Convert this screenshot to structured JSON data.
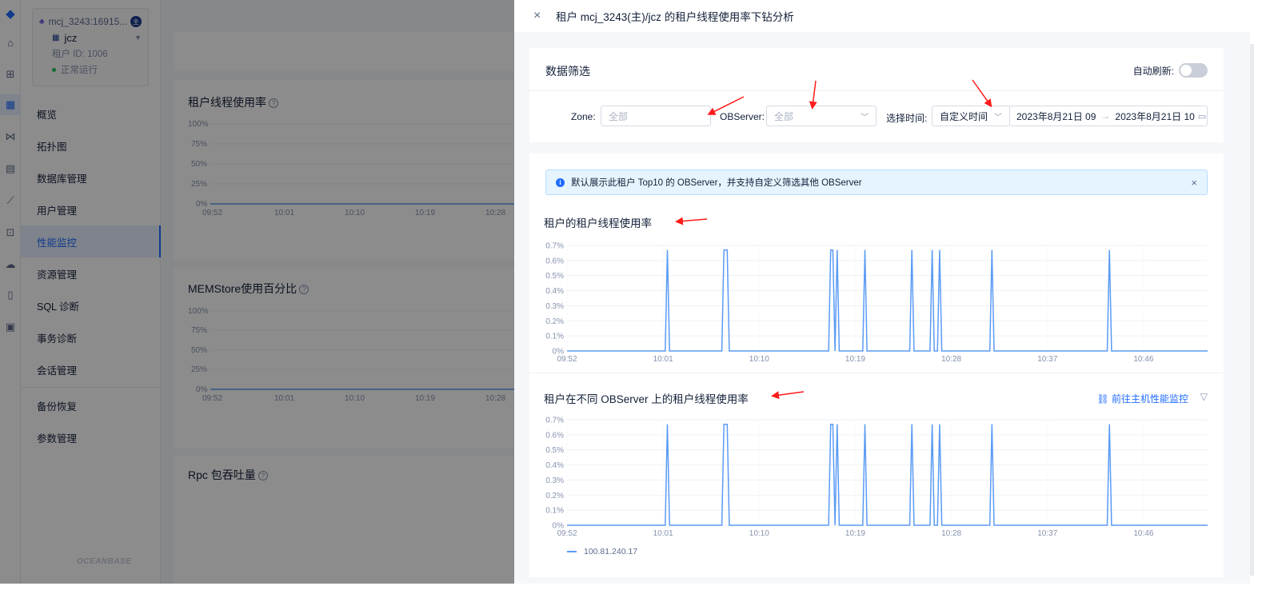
{
  "sidebar": {
    "cluster_name": "mcj_3243:16915...",
    "tenant_name": "jcz",
    "tenant_id": "租户 ID: 1006",
    "status": "正常运行",
    "nav": [
      "概览",
      "拓扑图",
      "数据库管理",
      "用户管理",
      "性能监控",
      "资源管理",
      "SQL 诊断",
      "事务诊断",
      "会话管理",
      "备份恢复",
      "参数管理"
    ],
    "active_item": "性能监控",
    "brand": "OCEANBASE"
  },
  "background_panels": {
    "panel1_title": "租户线程使用率",
    "panel2_title": "MEMStore使用百分比",
    "panel3_title": "Rpc 包吞吐量",
    "y_ticks": [
      "100%",
      "75%",
      "50%",
      "25%",
      "0%"
    ],
    "x_ticks": [
      "09:52",
      "10:01",
      "10:10",
      "10:19",
      "10:28"
    ]
  },
  "drawer": {
    "close_label": "×",
    "title": "租户 mcj_3243(主)/jcz 的租户线程使用率下钻分析",
    "filter_title": "数据筛选",
    "auto_refresh_label": "自动刷新:",
    "zone_label": "Zone:",
    "zone_value": "全部",
    "observer_label": "OBServer:",
    "observer_value": "全部",
    "time_label": "选择时间:",
    "time_mode": "自定义时间",
    "time_start": "2023年8月21日 09",
    "time_arrow": "→",
    "time_end": "2023年8月21日 10",
    "alert_text": "默认展示此租户 Top10 的 OBServer，并支持自定义筛选其他 OBServer",
    "section1_title": "租户的租户线程使用率",
    "section2_title": "租户在不同 OBServer 上的租户线程使用率",
    "link_text": "前往主机性能监控",
    "legend_label": "100.81.240.17"
  },
  "colors": {
    "accent": "#1f6bff",
    "series": "#5b9bf5",
    "arrow": "#ff1a1a"
  },
  "chart_data": [
    {
      "type": "line",
      "title": "租户的租户线程使用率",
      "y_ticks": [
        "0.7%",
        "0.6%",
        "0.5%",
        "0.4%",
        "0.3%",
        "0.2%",
        "0.1%",
        "0%"
      ],
      "x_ticks": [
        "09:52",
        "10:01",
        "10:10",
        "10:19",
        "10:28",
        "10:37",
        "10:46"
      ],
      "ylim": [
        0,
        0.7
      ],
      "x_range": [
        0,
        60
      ],
      "series": [
        {
          "values": [
            [
              0,
              0
            ],
            [
              9.2,
              0
            ],
            [
              9.4,
              0.67
            ],
            [
              9.6,
              0
            ],
            [
              14.5,
              0
            ],
            [
              14.7,
              0.67
            ],
            [
              15.0,
              0.67
            ],
            [
              15.2,
              0
            ],
            [
              24.5,
              0
            ],
            [
              24.7,
              0.67
            ],
            [
              24.9,
              0.67
            ],
            [
              25.1,
              0
            ],
            [
              25.3,
              0.67
            ],
            [
              25.5,
              0
            ],
            [
              27.7,
              0
            ],
            [
              27.9,
              0.67
            ],
            [
              28.1,
              0
            ],
            [
              32.1,
              0
            ],
            [
              32.3,
              0.67
            ],
            [
              32.5,
              0
            ],
            [
              34.0,
              0
            ],
            [
              34.2,
              0.67
            ],
            [
              34.4,
              0
            ],
            [
              34.7,
              0
            ],
            [
              34.9,
              0.67
            ],
            [
              35.1,
              0
            ],
            [
              39.6,
              0
            ],
            [
              39.8,
              0.67
            ],
            [
              40.0,
              0
            ],
            [
              50.6,
              0
            ],
            [
              50.8,
              0.67
            ],
            [
              51.0,
              0
            ],
            [
              60,
              0
            ]
          ]
        }
      ]
    },
    {
      "type": "line",
      "title": "租户在不同 OBServer 上的租户线程使用率",
      "y_ticks": [
        "0.7%",
        "0.6%",
        "0.5%",
        "0.4%",
        "0.3%",
        "0.2%",
        "0.1%",
        "0%"
      ],
      "x_ticks": [
        "09:52",
        "10:01",
        "10:10",
        "10:19",
        "10:28",
        "10:37",
        "10:46"
      ],
      "ylim": [
        0,
        0.7
      ],
      "x_range": [
        0,
        60
      ],
      "series": [
        {
          "name": "100.81.240.17",
          "values": [
            [
              0,
              0
            ],
            [
              9.2,
              0
            ],
            [
              9.4,
              0.67
            ],
            [
              9.6,
              0
            ],
            [
              14.5,
              0
            ],
            [
              14.7,
              0.67
            ],
            [
              15.0,
              0.67
            ],
            [
              15.2,
              0
            ],
            [
              24.5,
              0
            ],
            [
              24.7,
              0.67
            ],
            [
              24.9,
              0.67
            ],
            [
              25.1,
              0
            ],
            [
              25.3,
              0.67
            ],
            [
              25.5,
              0
            ],
            [
              27.7,
              0
            ],
            [
              27.9,
              0.67
            ],
            [
              28.1,
              0
            ],
            [
              32.1,
              0
            ],
            [
              32.3,
              0.67
            ],
            [
              32.5,
              0
            ],
            [
              34.0,
              0
            ],
            [
              34.2,
              0.67
            ],
            [
              34.4,
              0
            ],
            [
              34.7,
              0
            ],
            [
              34.9,
              0.67
            ],
            [
              35.1,
              0
            ],
            [
              39.6,
              0
            ],
            [
              39.8,
              0.67
            ],
            [
              40.0,
              0
            ],
            [
              50.6,
              0
            ],
            [
              50.8,
              0.67
            ],
            [
              51.0,
              0
            ],
            [
              60,
              0
            ]
          ]
        }
      ]
    }
  ]
}
